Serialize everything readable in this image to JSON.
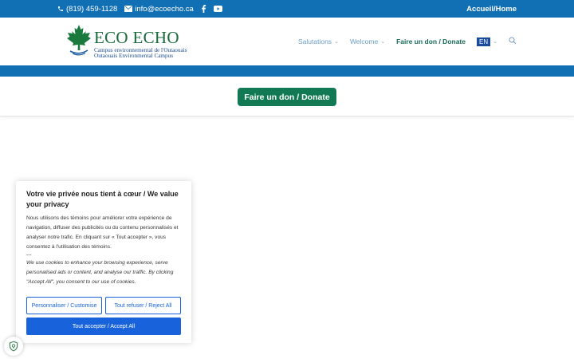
{
  "topbar": {
    "phone": "(819) 459-1128",
    "email": "info@ecoecho.ca",
    "social_icons": [
      "facebook-icon",
      "youtube-icon"
    ],
    "home_link": "Accueil/Home"
  },
  "logo": {
    "name": "ECO ECHO",
    "subtitle_fr": "Campus environnemental de l'Outaouais",
    "subtitle_en": "Outaouais Environmental Campus"
  },
  "nav": {
    "items": [
      {
        "label": "Salutations",
        "has_dropdown": true
      },
      {
        "label": "Welcome",
        "has_dropdown": true
      },
      {
        "label": "Faire un don / Donate",
        "has_dropdown": false
      }
    ],
    "language": "EN"
  },
  "donate": {
    "label": "Faire un don / Donate"
  },
  "cookie": {
    "title": "Votre vie privée nous tient à cœur / We value your privacy",
    "body_fr": "Nous utilisons des témoins pour améliorer votre expérience de navigation, diffuser des publicités ou du contenu personnalisés et analyser notre trafic. En cliquant sur « Tout accepter », vous consentez à l'utilisation des témoins.",
    "separator": "---",
    "body_en": "We use cookies to enhance your browsing experience, serve personalised ads or content, and analyse our traffic. By clicking \"Accept All\", you consent to our use of cookies.",
    "customize_label": "Personnaliser / Customise",
    "reject_label": "Tout refuser / Reject All",
    "accept_label": "Tout accepter / Accept All"
  },
  "colors": {
    "brand_blue": "#116fb4",
    "brand_green": "#117a55",
    "cookie_blue": "#1863dc"
  }
}
